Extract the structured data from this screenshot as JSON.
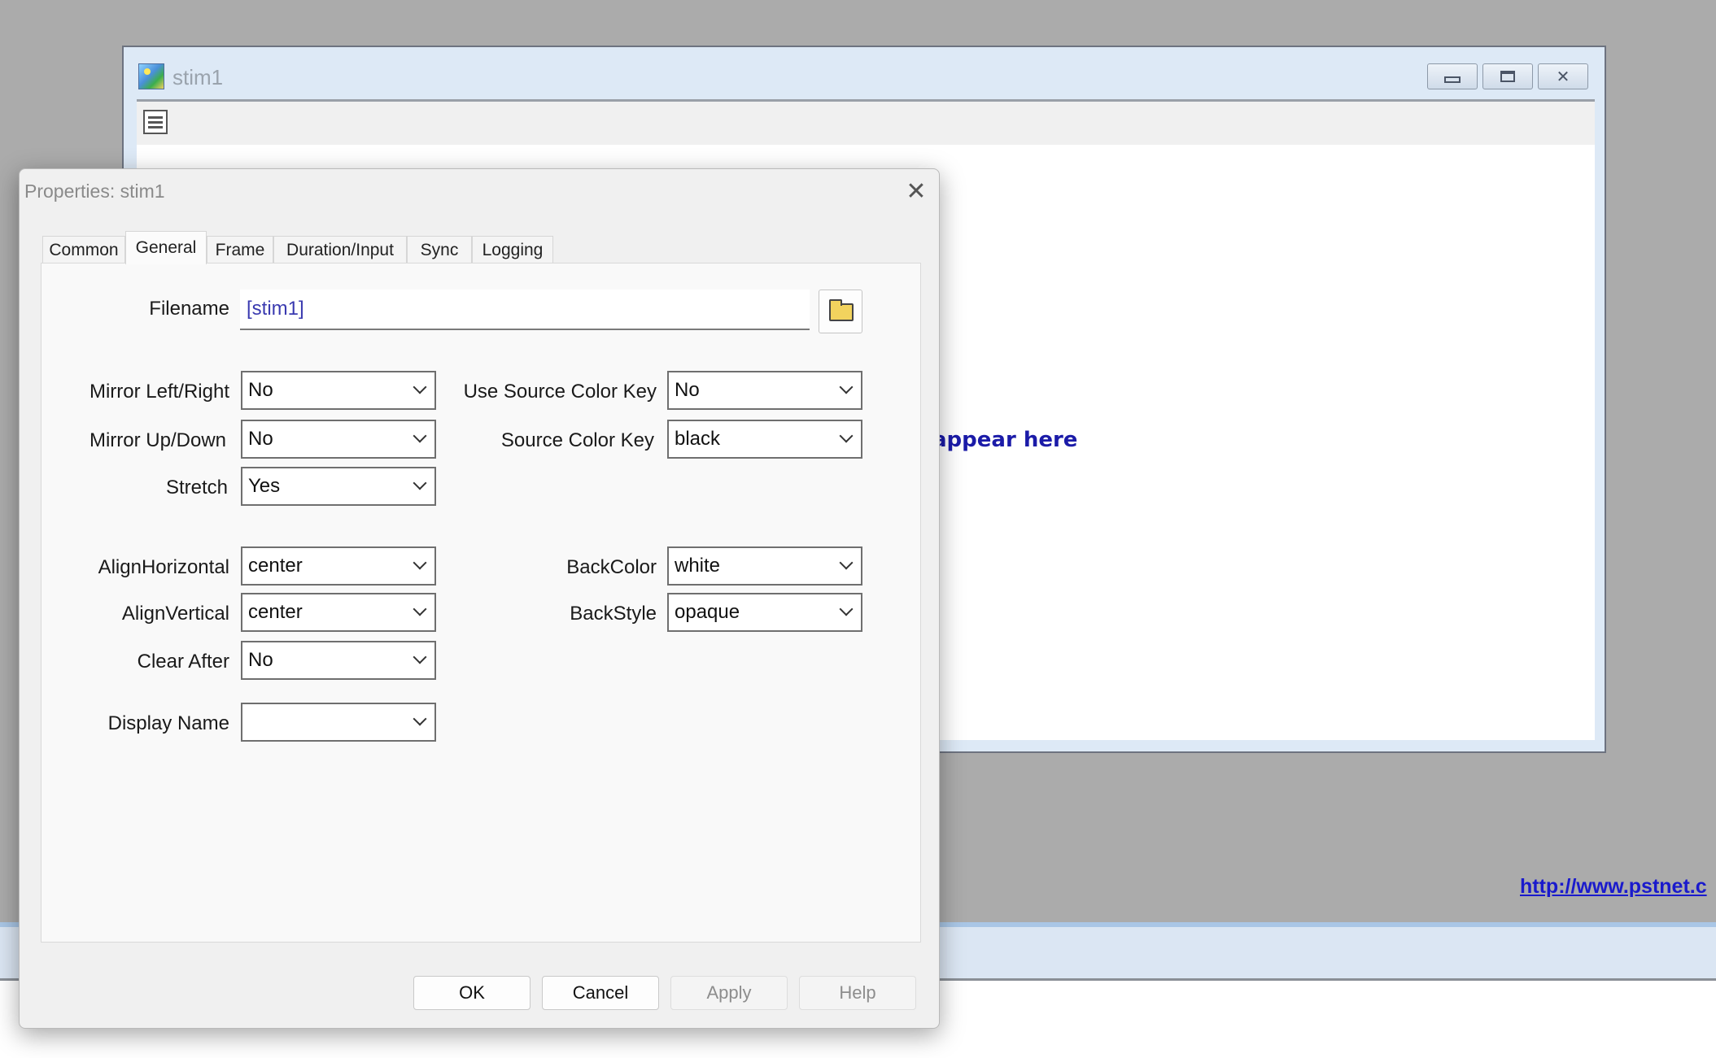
{
  "stim_window": {
    "title": "stim1",
    "canvas_text": "appear here",
    "link_text": "http://www.pstnet.c"
  },
  "dialog": {
    "title": "Properties: stim1",
    "tabs": [
      {
        "label": "Common"
      },
      {
        "label": "General"
      },
      {
        "label": "Frame"
      },
      {
        "label": "Duration/Input"
      },
      {
        "label": "Sync"
      },
      {
        "label": "Logging"
      }
    ],
    "active_tab": "General",
    "fields": {
      "filename": {
        "label": "Filename",
        "value": "[stim1]"
      },
      "mirror_lr": {
        "label": "Mirror Left/Right",
        "value": "No"
      },
      "mirror_ud": {
        "label": "Mirror Up/Down",
        "value": "No"
      },
      "stretch": {
        "label": "Stretch",
        "value": "Yes"
      },
      "use_source_color_key": {
        "label": "Use Source Color Key",
        "value": "No"
      },
      "source_color_key": {
        "label": "Source Color Key",
        "value": "black"
      },
      "align_horizontal": {
        "label": "AlignHorizontal",
        "value": "center"
      },
      "align_vertical": {
        "label": "AlignVertical",
        "value": "center"
      },
      "clear_after": {
        "label": "Clear After",
        "value": "No"
      },
      "back_color": {
        "label": "BackColor",
        "value": "white"
      },
      "back_style": {
        "label": "BackStyle",
        "value": "opaque"
      },
      "display_name": {
        "label": "Display Name",
        "value": ""
      }
    },
    "buttons": {
      "ok": "OK",
      "cancel": "Cancel",
      "apply": "Apply",
      "help": "Help"
    }
  }
}
